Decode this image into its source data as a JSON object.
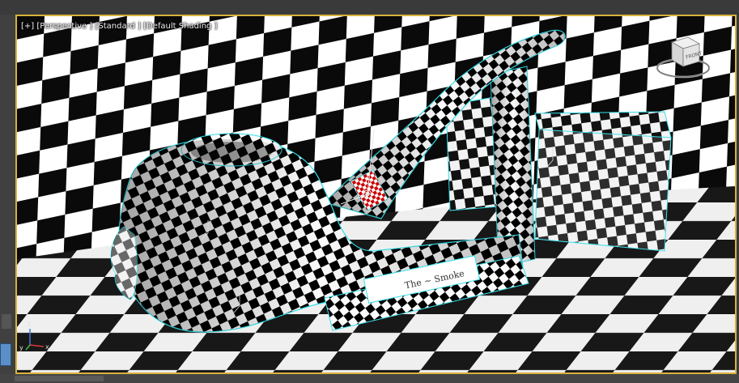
{
  "viewport": {
    "label_plus": "[+]",
    "label_view": "[Perspective ]",
    "label_mode": "[Standard ]",
    "label_shading": "[Default Shading ]"
  },
  "viewcube": {
    "face_label": "FRONT"
  },
  "axis_tripod": {
    "x": "x",
    "y": "y",
    "z": "z"
  },
  "colors": {
    "viewport_border": "#d8b23a",
    "selection_outline": "#35e0ea",
    "checker_dark": "#000000",
    "checker_light": "#ffffff"
  }
}
